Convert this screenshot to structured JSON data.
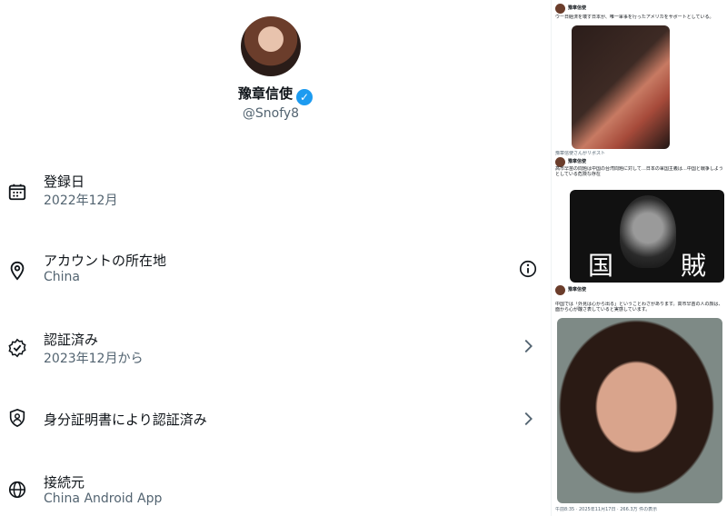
{
  "profile": {
    "display_name": "豫章信使",
    "handle": "@Snofy8",
    "verified_icon": "verified-badge-icon"
  },
  "rows": [
    {
      "title": "登録日",
      "sub": "2022年12月",
      "icon": "calendar-icon"
    },
    {
      "title": "アカウントの所在地",
      "sub": "China",
      "icon": "location-pin-icon",
      "right": "info-icon"
    },
    {
      "title": "認証済み",
      "sub": "2023年12月から",
      "icon": "verified-outline-icon",
      "right": "chevron-right-icon"
    },
    {
      "title": "身分証明書により認証済み",
      "icon": "id-shield-icon",
      "right": "chevron-right-icon"
    },
    {
      "title": "接続元",
      "sub": "China Android App",
      "icon": "globe-icon"
    }
  ],
  "side": {
    "post1_name": "豫章信使",
    "post1_text": "ウー日経済を壊す日本が、唯一軍事を行ったアメリカをサポートとしている。",
    "repost_label": "豫章信使さんがリポスト",
    "post2_name": "豫章信使",
    "post2_text": "高市早苗の問題は中国の台湾問題に対して…日本の軍国主義は…中国と戦争しようとしている危険な存在",
    "poster_chars": [
      "国",
      "賊"
    ],
    "post3_name": "豫章信使",
    "post3_text": "中国では「外見は心から出る」ということわざがあります。高市早苗の人の顔は、面から心が醜さ表していると実感しています。",
    "footer_text": "午前8:35 · 2025年11月17日 · 266.3万 件の表示"
  },
  "colors": {
    "accent": "#1d9bf0",
    "text": "#0f1419",
    "muted": "#536471"
  }
}
